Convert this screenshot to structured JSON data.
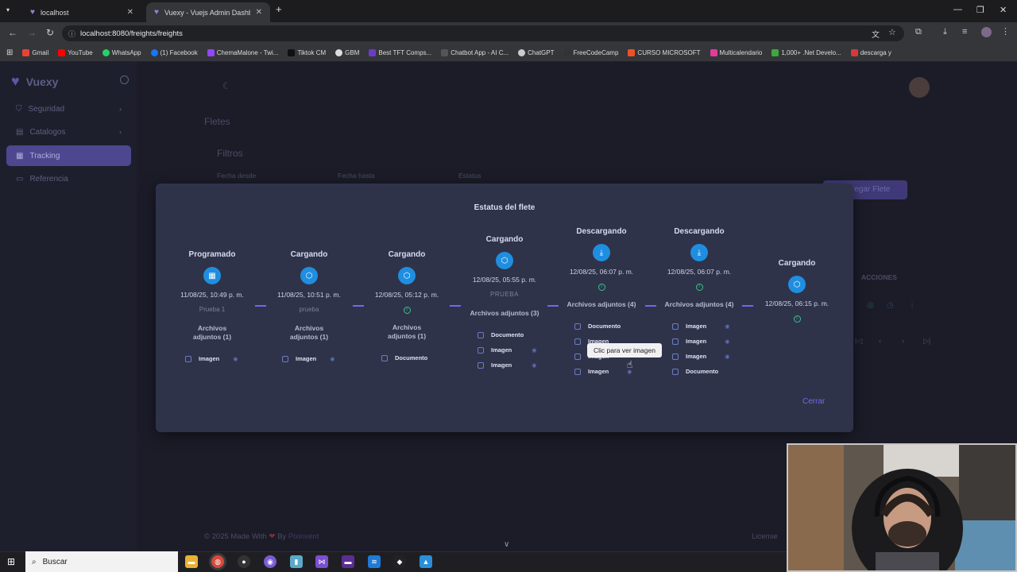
{
  "browser": {
    "tabs": [
      {
        "title": "localhost"
      },
      {
        "title": "Vuexy - Vuejs Admin Dashboar"
      }
    ],
    "url": "localhost:8080/freights/freights",
    "bookmarks": [
      "Gmail",
      "YouTube",
      "WhatsApp",
      "(1) Facebook",
      "ChemaMalone - Twi...",
      "Tiktok CM",
      "GBM",
      "Best TFT Comps...",
      "Chatbot App - AI C...",
      "ChatGPT",
      "FreeCodeCamp",
      "CURSO MICROSOFT",
      "Multicalendario",
      "1,000+ .Net Develo...",
      "descarga y"
    ]
  },
  "app": {
    "brand": "Vuexy",
    "nav": [
      {
        "label": "Seguridad"
      },
      {
        "label": "Catalogos"
      },
      {
        "label": "Tracking"
      },
      {
        "label": "Referencia"
      }
    ],
    "page_title": "Fletes",
    "filters_title": "Filtros",
    "filter_labels": [
      "Fecha desde",
      "Fecha hasta",
      "Estatus"
    ],
    "add_button": "regar Flete",
    "acciones": "ACCIONES",
    "footer": "© 2025 Made With",
    "footer_by": "By",
    "footer_brand": "Pixinvent",
    "license": "License"
  },
  "modal": {
    "title": "Estatus del flete",
    "close_label": "Cerrar",
    "tooltip": "Clic para ver imagen",
    "steps": [
      {
        "status": "Programado",
        "date": "11/08/25, 10:49 p. m.",
        "note": "Prueba 1",
        "attachments": "Archivos adjuntos (1)",
        "files": [
          "Imagen"
        ]
      },
      {
        "status": "Cargando",
        "date": "11/08/25, 10:51 p. m.",
        "note": "prueba",
        "attachments": "Archivos adjuntos (1)",
        "files": [
          "Imagen"
        ]
      },
      {
        "status": "Cargando",
        "date": "12/08/25, 05:12 p. m.",
        "note": "",
        "attachments": "Archivos adjuntos (1)",
        "files": [
          "Documento"
        ]
      },
      {
        "status": "Cargando",
        "date": "12/08/25, 05:55 p. m.",
        "note": "PRUEBA",
        "attachments": "Archivos adjuntos (3)",
        "files": [
          "Documento",
          "Imagen",
          "Imagen"
        ]
      },
      {
        "status": "Descargando",
        "date": "12/08/25, 06:07 p. m.",
        "note": "",
        "attachments": "Archivos adjuntos (4)",
        "files": [
          "Documento",
          "Imagen",
          "Imagen",
          "Imagen"
        ]
      },
      {
        "status": "Descargando",
        "date": "12/08/25, 06:07 p. m.",
        "note": "",
        "attachments": "Archivos adjuntos (4)",
        "files": [
          "Imagen",
          "Imagen",
          "Imagen",
          "Documento"
        ]
      },
      {
        "status": "Cargando",
        "date": "12/08/25, 06:15 p. m.",
        "note": "",
        "attachments": "",
        "files": []
      }
    ]
  },
  "taskbar": {
    "search": "Buscar"
  }
}
